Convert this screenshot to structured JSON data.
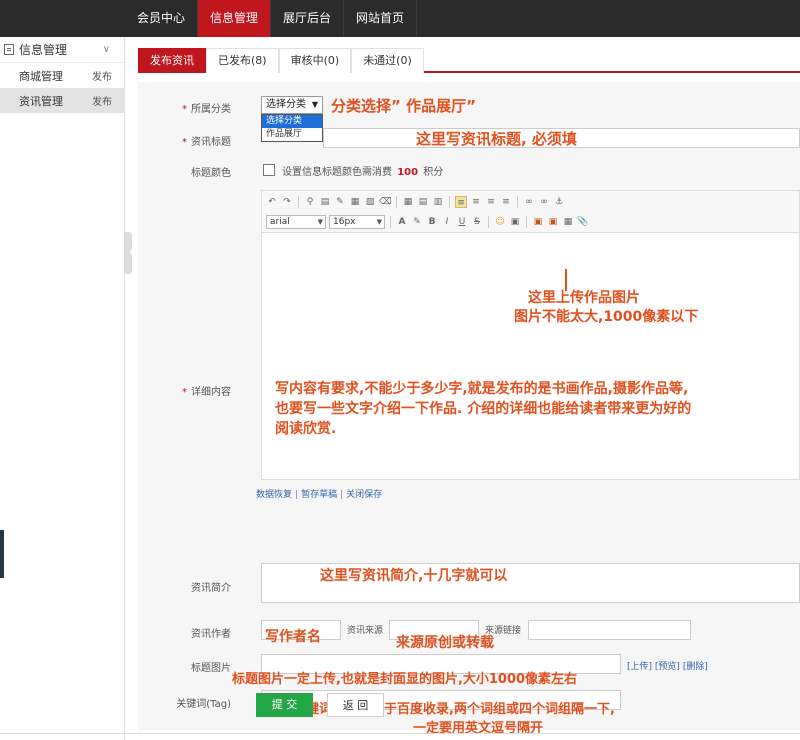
{
  "topnav": {
    "items": [
      {
        "label": "会员中心",
        "active": false
      },
      {
        "label": "信息管理",
        "active": true
      },
      {
        "label": "展厅后台",
        "active": false
      },
      {
        "label": "网站首页",
        "active": false
      }
    ]
  },
  "sidebar": {
    "heading": "信息管理",
    "items": [
      {
        "label": "商城管理",
        "tag": "发布",
        "active": false
      },
      {
        "label": "资讯管理",
        "tag": "发布",
        "active": true
      }
    ]
  },
  "tabs": [
    {
      "label": "发布资讯",
      "active": true
    },
    {
      "label": "已发布(8)",
      "active": false
    },
    {
      "label": "审核中(0)",
      "active": false
    },
    {
      "label": "未通过(0)",
      "active": false
    }
  ],
  "form": {
    "category": {
      "label": "所属分类",
      "selected": "选择分类",
      "options": [
        "选择分类",
        "作品展厅"
      ],
      "annotation": "分类选择” 作品展厅”"
    },
    "title": {
      "label": "资讯标题",
      "annotation": "这里写资讯标题, 必须填"
    },
    "title_color": {
      "label": "标题颜色",
      "text_prefix": "设置信息标题颜色需消费",
      "points": "100",
      "text_suffix": "积分"
    },
    "content": {
      "label": "详细内容",
      "font_family": "arial",
      "font_size": "16px",
      "annotation_upload_1": "这里上传作品图片",
      "annotation_upload_2": "图片不能太大,1000像素以下",
      "annotation_body_1": "写内容有要求,不能少于多少字,就是发布的是书画作品,摄影作品等,",
      "annotation_body_2": "也要写一些文字介绍一下作品. 介绍的详细也能给读者带来更为好的",
      "annotation_body_3": "阅读欣赏.",
      "links": [
        "数据恢复",
        "暂存草稿",
        "关闭保存"
      ]
    },
    "summary": {
      "label": "资讯简介",
      "annotation": "这里写资讯简介,十几字就可以"
    },
    "author": {
      "label": "资讯作者",
      "annotation": "写作者名",
      "source_label": "资讯来源",
      "source_annotation": "来源原创或转载",
      "source_link_label": "来源链接"
    },
    "title_image": {
      "label": "标题图片",
      "links": [
        "[上传]",
        "[预览]",
        "[删除]"
      ],
      "annotation": "标题图片一定上传,也就是封面显的图片,大小1000像素左右"
    },
    "tags": {
      "label": "关键词(Tag)",
      "annotation_1": "关键词填写有利于百度收录,两个词组或四个词组隔一下,",
      "annotation_2": "一定要用英文逗号隔开"
    },
    "submit_label": "提 交",
    "back_label": "返 回"
  },
  "colors": {
    "topbar": "#2b2b2b",
    "accent": "#c0161e",
    "annotation": "#e1511f",
    "submit": "#24a548",
    "points": "#c0161e"
  }
}
